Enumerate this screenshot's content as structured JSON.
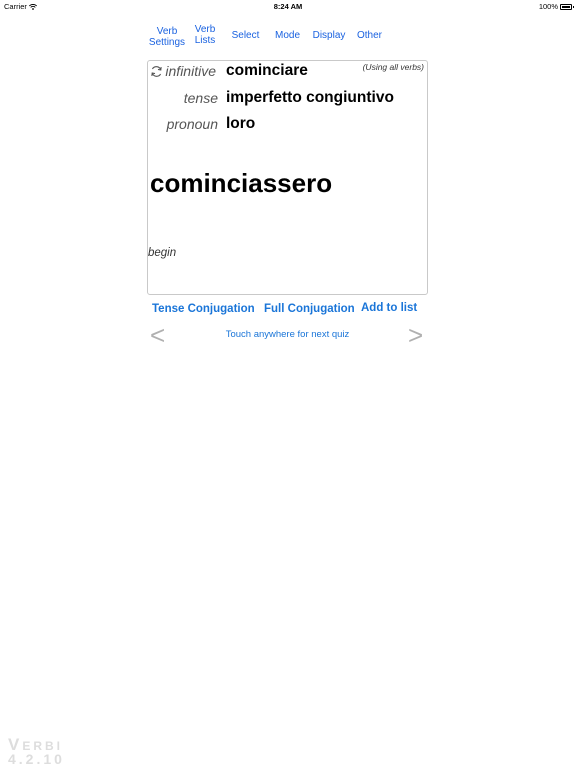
{
  "status_bar": {
    "carrier": "Carrier",
    "time": "8:24 AM",
    "battery": "100%"
  },
  "toolbar": {
    "verb_settings_line1": "Verb",
    "verb_settings_line2": "Settings",
    "verb_lists_line1": "Verb",
    "verb_lists_line2": "Lists",
    "select": "Select",
    "mode": "Mode",
    "display": "Display",
    "other": "Other"
  },
  "quiz": {
    "using_note": "(Using all verbs)",
    "infinitive_label": "infinitive",
    "infinitive_value": "cominciare",
    "tense_label": "tense",
    "tense_value": "imperfetto congiuntivo",
    "pronoun_label": "pronoun",
    "pronoun_value": "loro",
    "answer": "cominciassero",
    "meaning": "begin"
  },
  "actions": {
    "tense_conjugation": "Tense Conjugation",
    "full_conjugation": "Full Conjugation",
    "add_to_list": "Add to list"
  },
  "navigation": {
    "prev": "<",
    "next": ">",
    "hint": "Touch anywhere for next quiz"
  },
  "watermark": {
    "name": "Verbi",
    "version": "4.2.10"
  },
  "colors": {
    "link": "#1a62e0",
    "action": "#1a75d8",
    "arrow": "#b0b0b0",
    "watermark": "#dddddd"
  }
}
